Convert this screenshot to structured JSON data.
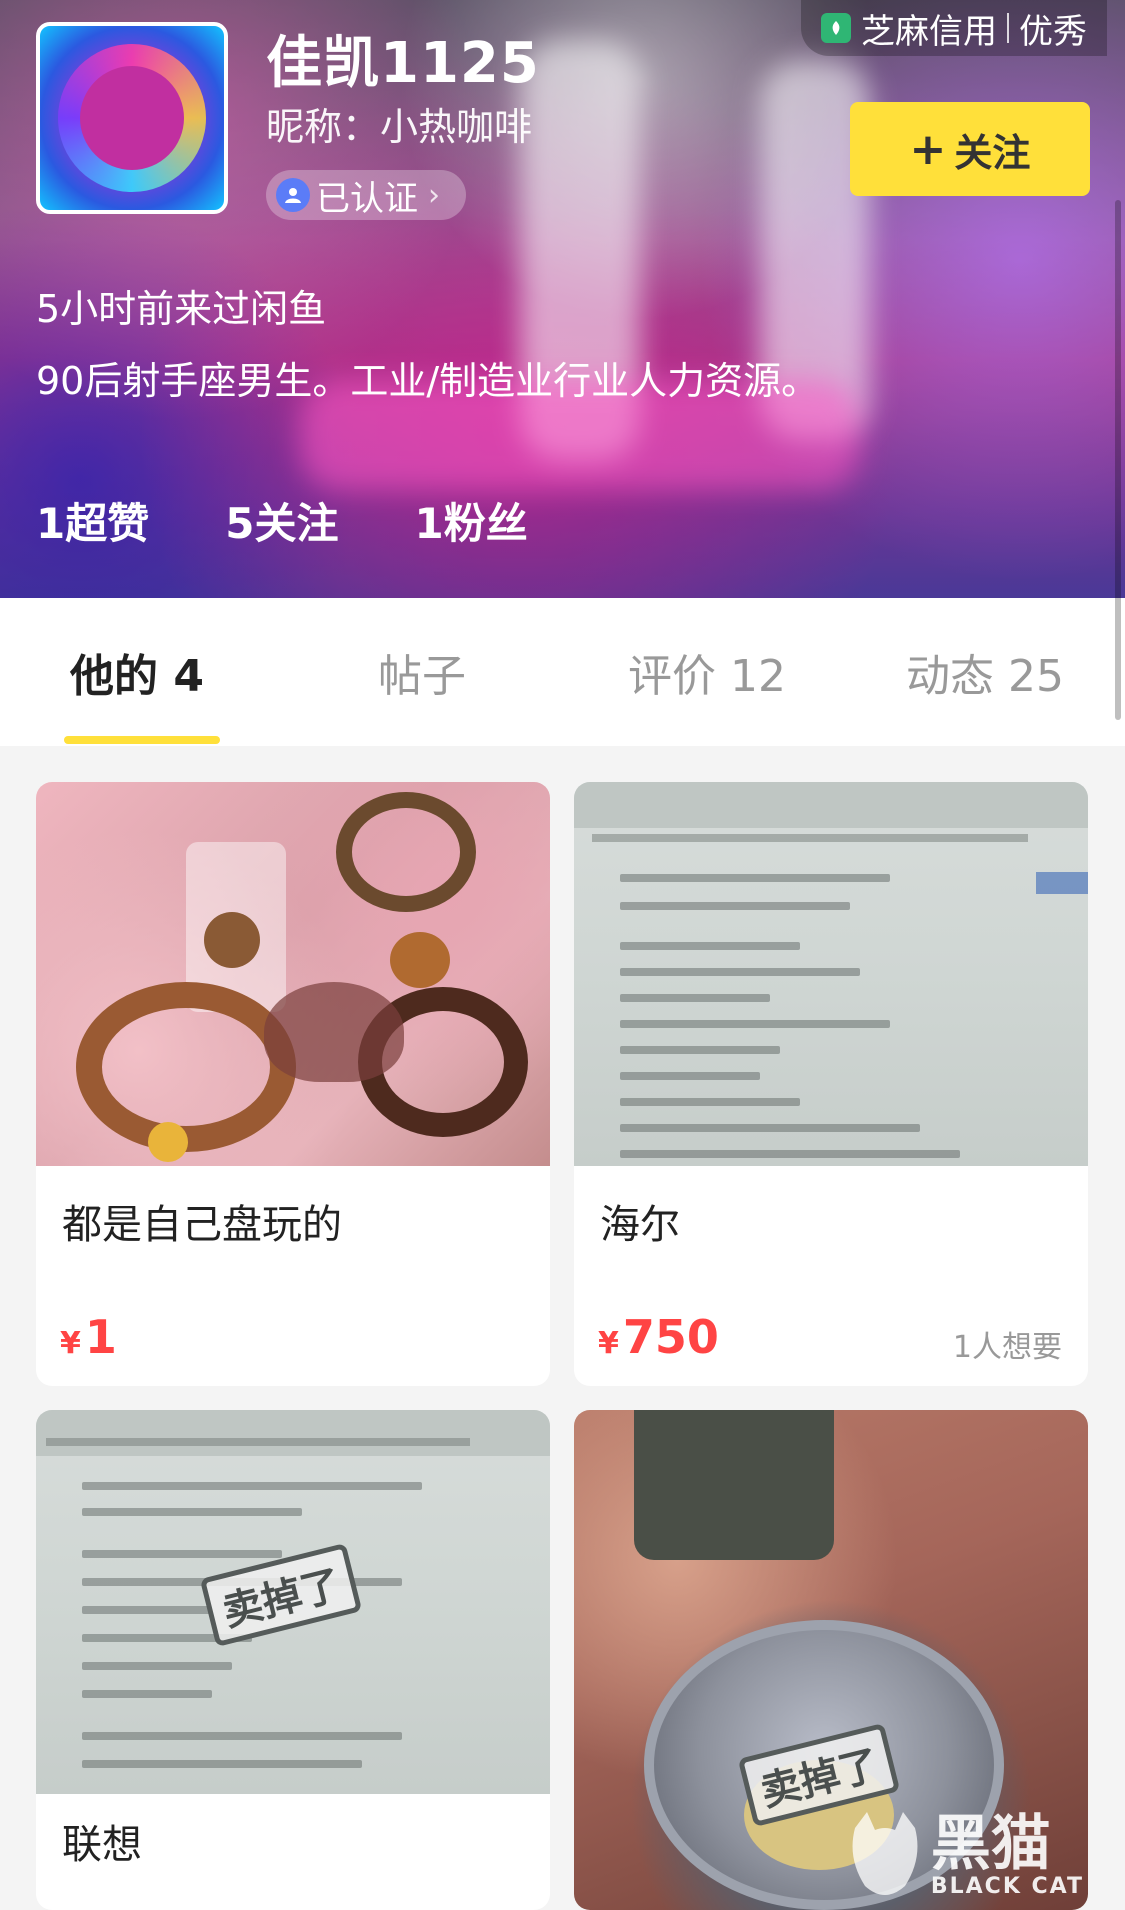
{
  "profile": {
    "username": "佳凯1125",
    "nickname": "昵称：小热咖啡",
    "verified_label": "已认证",
    "last_visit": "5小时前来过闲鱼",
    "bio": "90后射手座男生。工业/制造业行业人力资源。",
    "follow_button": "关注",
    "avatar_icon": "avatar-image"
  },
  "credit": {
    "label": "芝麻信用",
    "level": "优秀",
    "icon": "sesame-credit-icon",
    "color": "#2fb674"
  },
  "stats": [
    {
      "label": "1超赞"
    },
    {
      "label": "5关注"
    },
    {
      "label": "1粉丝"
    }
  ],
  "tabs": [
    {
      "label": "他的 4",
      "active": true
    },
    {
      "label": "帖子",
      "active": false
    },
    {
      "label": "评价 12",
      "active": false
    },
    {
      "label": "动态 25",
      "active": false
    }
  ],
  "products": [
    {
      "title": "都是自己盘玩的",
      "currency": "¥",
      "price": "1",
      "wants": "",
      "sold": false
    },
    {
      "title": "海尔",
      "currency": "¥",
      "price": "750",
      "wants": "1人想要",
      "sold": false
    },
    {
      "title": "联想",
      "currency": "",
      "price": "",
      "wants": "",
      "sold": true,
      "sold_label": "卖掉了"
    },
    {
      "title": "",
      "currency": "",
      "price": "",
      "wants": "",
      "sold": true,
      "sold_label": "卖掉了"
    }
  ],
  "watermark": {
    "main": "黑猫",
    "sub": "BLACK CAT"
  },
  "colors": {
    "accent_yellow": "#ffe03a",
    "price_red": "#ff4444",
    "tab_inactive": "#999999"
  }
}
